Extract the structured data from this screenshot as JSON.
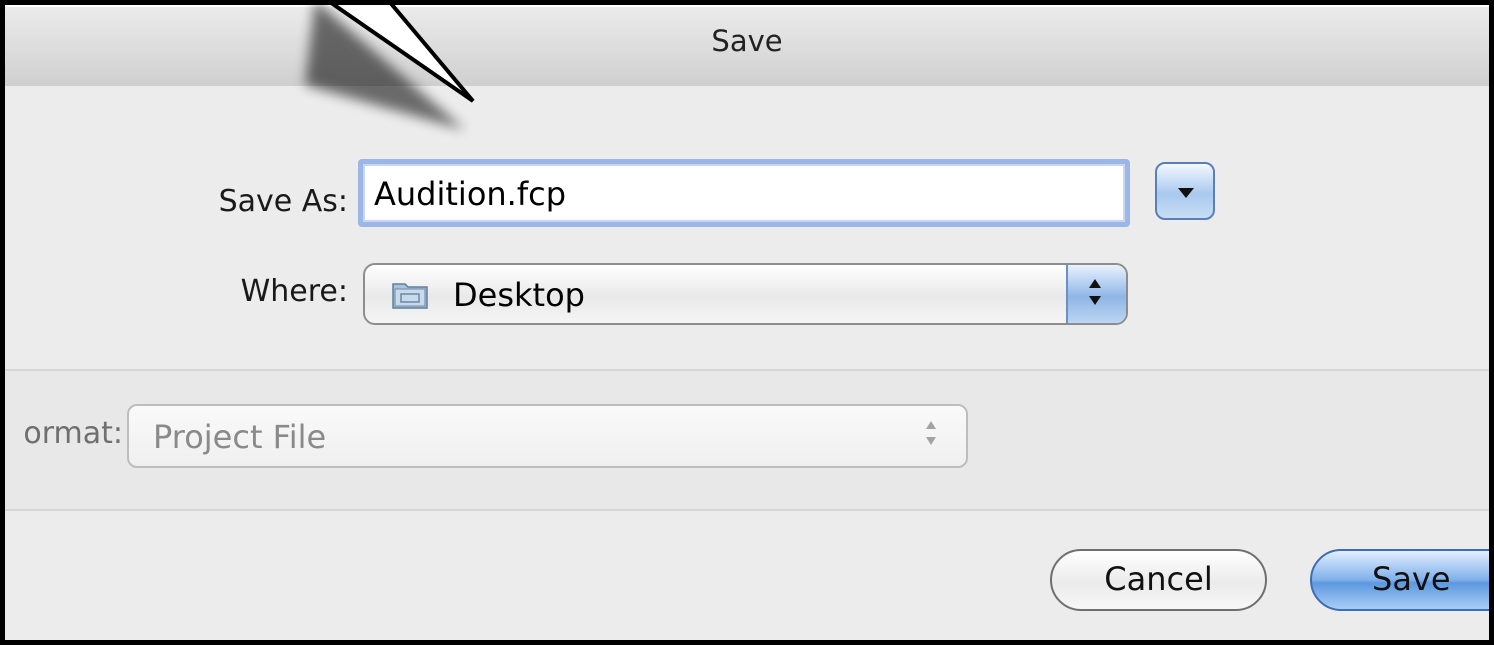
{
  "window": {
    "title": "Save"
  },
  "form": {
    "save_as_label": "Save As:",
    "save_as_value": "Audition.fcp",
    "where_label": "Where:",
    "where_value": "Desktop"
  },
  "format": {
    "label": "ormat:",
    "value": "Project File"
  },
  "buttons": {
    "cancel": "Cancel",
    "save": "Save"
  },
  "colors": {
    "accent": "#7fb0ea",
    "focus_ring": "#9cb6e8"
  }
}
